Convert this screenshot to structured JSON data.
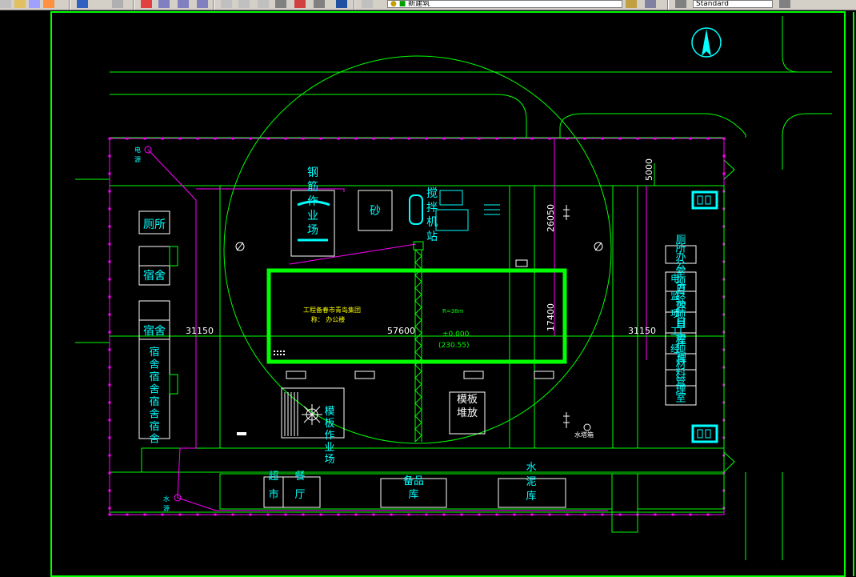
{
  "toolbar": {
    "layer_name": "新建筑",
    "text_style": "Standard"
  },
  "drawing": {
    "buildings": {
      "toilet_left": "厕所",
      "dorm_1": "宿舍",
      "dorm_2": "宿舍",
      "dorm_3_lines": [
        "宿",
        "舍",
        "宿",
        "舍",
        "宿",
        "舍",
        "宿",
        "舍"
      ],
      "steel_yard": [
        "钢",
        "筋",
        "作",
        "业",
        "场"
      ],
      "sand": "砂",
      "mixer": [
        "搅",
        "拌",
        "机",
        "站"
      ],
      "formwork_yard": [
        "模",
        "板",
        "作",
        "业",
        "场"
      ],
      "formwork_stack": [
        "模板",
        "堆放"
      ],
      "supermarket": [
        "超",
        "市"
      ],
      "canteen": [
        "餐",
        "厅"
      ],
      "spare_store": [
        "备品",
        "库"
      ],
      "cement_store": [
        "水",
        "泥",
        "库"
      ],
      "right_block": [
        "厕",
        "所",
        "办",
        "公",
        "室",
        "项",
        "目",
        "经",
        "理",
        "项",
        "目",
        "工",
        "程",
        "师",
        "室",
        "材",
        "料",
        "管",
        "理",
        "室"
      ],
      "right_block_overlay": [
        "电",
        "方",
        "监",
        "公",
        "项",
        "目",
        "工",
        "室",
        "经",
        "理"
      ]
    },
    "main_building": {
      "line1": "工程备春市青岛集团",
      "line2": "称：   办公楼",
      "radius": "R=38m",
      "elevation": "±0.000",
      "elevation_abs": "(230.55)"
    },
    "dimensions": {
      "dim_left": "31150",
      "dim_mid": "57600",
      "dim_right": "31150",
      "dim_5000": "5000",
      "dim_26050": "26050",
      "dim_17400": "17400"
    },
    "labels": {
      "power_source": "电源",
      "water_source": "水源",
      "water_tank": "水塔箱"
    },
    "colors": {
      "line": "#00ff00",
      "cyan": "#00ffff",
      "magenta": "#ff00ff",
      "building": "#00ff00",
      "frame": "#00ff00"
    }
  }
}
